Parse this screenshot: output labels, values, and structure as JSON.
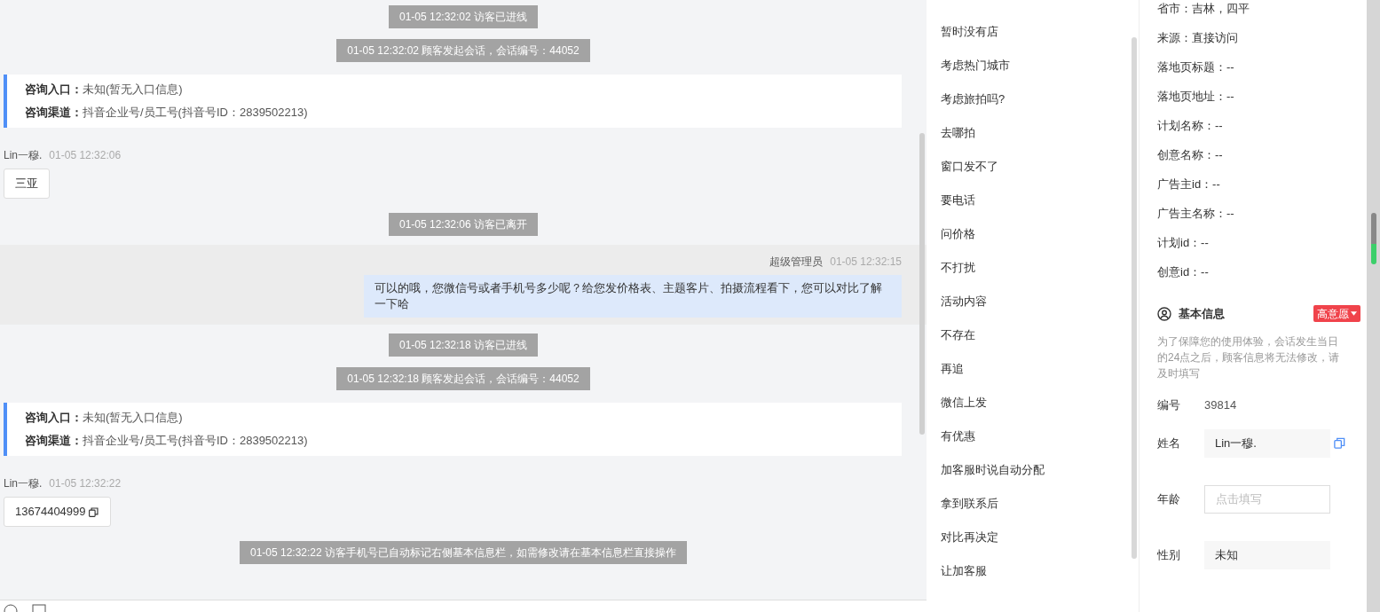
{
  "messages": [
    {
      "kind": "system",
      "text": "01-05 12:32:02 访客已进线"
    },
    {
      "kind": "system",
      "text": "01-05 12:32:02 顾客发起会话，会话编号：44052"
    },
    {
      "kind": "info",
      "lines": [
        {
          "label": "咨询入口：",
          "value": "未知(暂无入口信息)"
        },
        {
          "label": "咨询渠道：",
          "value": "抖音企业号/员工号(抖音号ID：2839502213)"
        }
      ]
    },
    {
      "kind": "visitor",
      "name": "Lin一穆.",
      "time": "01-05 12:32:06",
      "text": "三亚",
      "copy": false
    },
    {
      "kind": "system",
      "text": "01-05 12:32:06 访客已离开"
    },
    {
      "kind": "agent",
      "name": "超级管理员",
      "time": "01-05 12:32:15",
      "text": "可以的哦，您微信号或者手机号多少呢？给您发价格表、主题客片、拍摄流程看下，您可以对比了解一下哈"
    },
    {
      "kind": "system",
      "text": "01-05 12:32:18 访客已进线"
    },
    {
      "kind": "system",
      "text": "01-05 12:32:18 顾客发起会话，会话编号：44052"
    },
    {
      "kind": "info",
      "lines": [
        {
          "label": "咨询入口：",
          "value": "未知(暂无入口信息)"
        },
        {
          "label": "咨询渠道：",
          "value": "抖音企业号/员工号(抖音号ID：2839502213)"
        }
      ]
    },
    {
      "kind": "visitor",
      "name": "Lin一穆.",
      "time": "01-05 12:32:22",
      "text": "13674404999",
      "copy": true
    },
    {
      "kind": "system",
      "text": "01-05 12:32:22 访客手机号已自动标记右侧基本信息栏，如需修改请在基本信息栏直接操作"
    }
  ],
  "quick_replies": [
    "暂时没有店",
    "考虑热门城市",
    "考虑旅拍吗?",
    "去哪拍",
    "窗口发不了",
    "要电话",
    "问价格",
    "不打扰",
    "活动内容",
    "不存在",
    "再追",
    "微信上发",
    "有优惠",
    "加客服时说自动分配",
    "拿到联系后",
    "对比再决定",
    "让加客服"
  ],
  "source_fields": [
    "省市：吉林，四平",
    "来源：直接访问",
    "落地页标题：--",
    "落地页地址：--",
    "计划名称：--",
    "创意名称：--",
    "广告主id：--",
    "广告主名称：--",
    "计划id：--",
    "创意id：--"
  ],
  "basic_info": {
    "title": "基本信息",
    "intent_tag": "高意愿",
    "notice": "为了保障您的使用体验，会话发生当日的24点之后，顾客信息将无法修改，请及时填写",
    "fields": [
      {
        "kind": "text",
        "label": "编号",
        "value": "39814"
      },
      {
        "kind": "filled",
        "label": "姓名",
        "value": "Lin一穆.",
        "copy": true
      },
      {
        "kind": "input",
        "label": "年龄",
        "placeholder": "点击填写"
      },
      {
        "kind": "filled",
        "label": "性别",
        "value": "未知",
        "copy": false
      }
    ]
  }
}
